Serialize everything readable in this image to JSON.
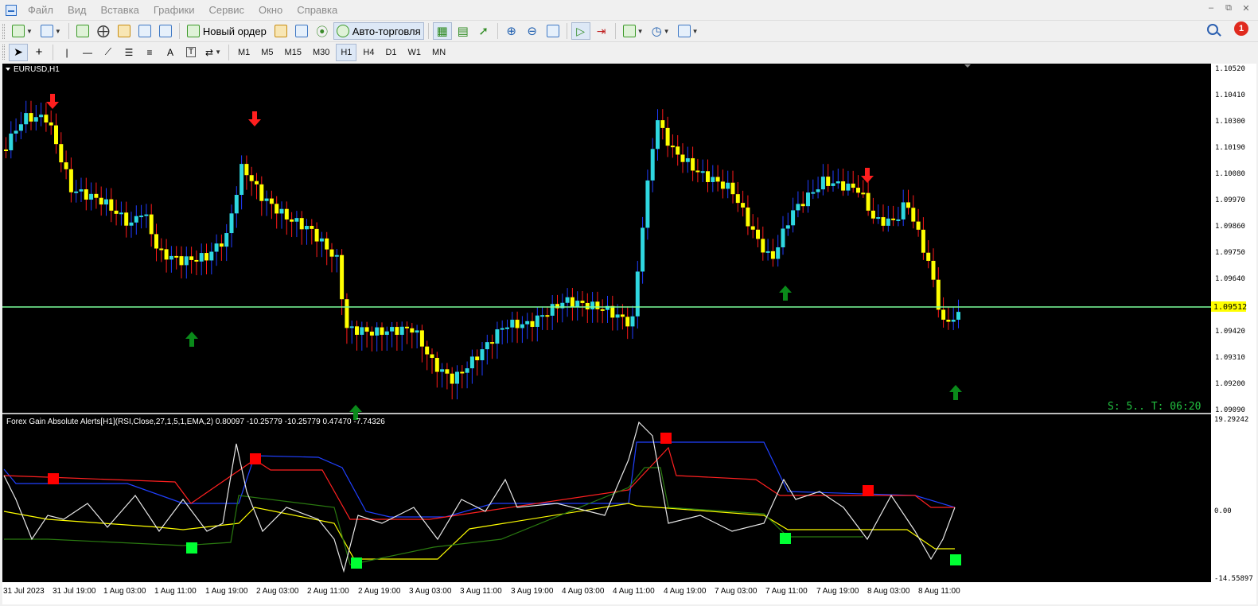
{
  "menu": [
    "Файл",
    "Вид",
    "Вставка",
    "Графики",
    "Сервис",
    "Окно",
    "Справка"
  ],
  "toolbar": {
    "new_order_label": "Новый ордер",
    "autotrade_label": "Авто-торговля",
    "timeframes": [
      "M1",
      "M5",
      "M15",
      "M30",
      "H1",
      "H4",
      "D1",
      "W1",
      "MN"
    ],
    "active_timeframe": "H1",
    "notifications_count": "1"
  },
  "chart": {
    "symbol_label": "EURUSD,H1",
    "current_price": "1.09512",
    "timer_text": "S: 5.. T: 06:20",
    "price_axis": [
      "1.10520",
      "1.10410",
      "1.10300",
      "1.10190",
      "1.10080",
      "1.09970",
      "1.09860",
      "1.09750",
      "1.09640",
      "1.09420",
      "1.09310",
      "1.09200",
      "1.09090"
    ],
    "time_axis": [
      "31 Jul 2023",
      "31 Jul 19:00",
      "1 Aug 03:00",
      "1 Aug 11:00",
      "1 Aug 19:00",
      "2 Aug 03:00",
      "2 Aug 11:00",
      "2 Aug 19:00",
      "3 Aug 03:00",
      "3 Aug 11:00",
      "3 Aug 19:00",
      "4 Aug 03:00",
      "4 Aug 11:00",
      "4 Aug 19:00",
      "7 Aug 03:00",
      "7 Aug 11:00",
      "7 Aug 19:00",
      "8 Aug 03:00",
      "8 Aug 11:00"
    ]
  },
  "indicator": {
    "title": "Forex Gain Absolute Alerts[H1](RSI,Close,27,1,5,1,EMA,2) 0.80097 -10.25779 -10.25779 0.47470 -7.74326",
    "axis_top": "19.29242",
    "axis_zero": "0.00",
    "axis_bottom": "-14.55897"
  },
  "colors": {
    "bull": "#2fd7e0",
    "bear": "#ffff00",
    "wick_bull": "#1f3dff",
    "wick_bear": "#ff1a1a",
    "price_line": "#7cff9a",
    "arrow_up": "#0a8a1a",
    "arrow_down": "#ff1f1f",
    "timer": "#22c040"
  }
}
